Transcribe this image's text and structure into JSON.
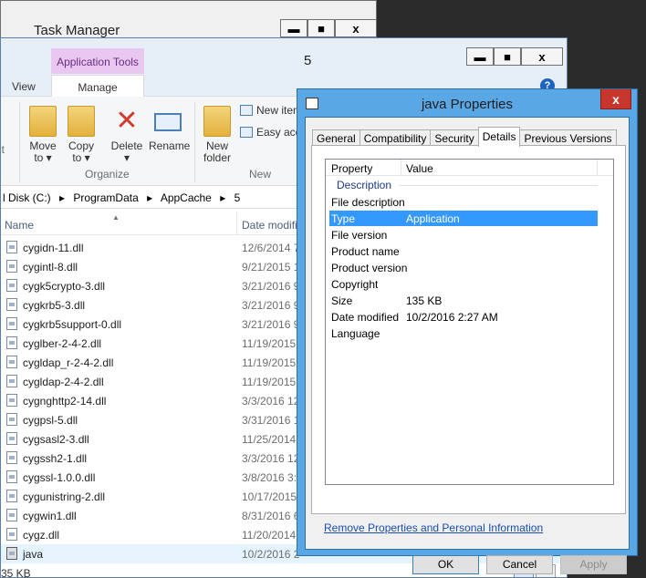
{
  "task_manager": {
    "title": "Task Manager",
    "min": "▬",
    "max": "■",
    "close": "x"
  },
  "explorer": {
    "contextual_tab": "Application Tools",
    "title_number": "5",
    "tabs": {
      "view": "View",
      "manage": "Manage"
    },
    "ribbon": {
      "move_to": "Move\nto ▾",
      "copy_to": "Copy\nto ▾",
      "delete": "Delete\n▾",
      "rename": "Rename",
      "new_folder": "New\nfolder",
      "new_item": "New item",
      "easy_access": "Easy access",
      "group_organize": "Organize",
      "group_new": "New",
      "cut_fragment": "ut"
    },
    "address": [
      "l Disk (C:)",
      "▸",
      "ProgramData",
      "▸",
      "AppCache",
      "▸",
      "5"
    ],
    "columns": {
      "name": "Name",
      "date": "Date modifi"
    },
    "files": [
      {
        "name": "cygidn-11.dll",
        "date": "12/6/2014 7"
      },
      {
        "name": "cygintl-8.dll",
        "date": "9/21/2015 1"
      },
      {
        "name": "cygk5crypto-3.dll",
        "date": "3/21/2016 9"
      },
      {
        "name": "cygkrb5-3.dll",
        "date": "3/21/2016 9"
      },
      {
        "name": "cygkrb5support-0.dll",
        "date": "3/21/2016 9"
      },
      {
        "name": "cyglber-2-4-2.dll",
        "date": "11/19/2015"
      },
      {
        "name": "cygldap_r-2-4-2.dll",
        "date": "11/19/2015"
      },
      {
        "name": "cygldap-2-4-2.dll",
        "date": "11/19/2015"
      },
      {
        "name": "cygnghttp2-14.dll",
        "date": "3/3/2016 12"
      },
      {
        "name": "cygpsl-5.dll",
        "date": "3/31/2016 1"
      },
      {
        "name": "cygsasl2-3.dll",
        "date": "11/25/2014"
      },
      {
        "name": "cygssh2-1.dll",
        "date": "3/3/2016 12"
      },
      {
        "name": "cygssl-1.0.0.dll",
        "date": "3/8/2016 3:4"
      },
      {
        "name": "cygunistring-2.dll",
        "date": "10/17/2015"
      },
      {
        "name": "cygwin1.dll",
        "date": "8/31/2016 6"
      },
      {
        "name": "cygz.dll",
        "date": "11/20/2014"
      },
      {
        "name": "java",
        "date": "10/2/2016 2"
      }
    ],
    "status_size": "35 KB"
  },
  "dialog": {
    "title": "java Properties",
    "close": "x",
    "tabs": [
      "General",
      "Compatibility",
      "Security",
      "Details",
      "Previous Versions"
    ],
    "active_tab": "Details",
    "table": {
      "col_property": "Property",
      "col_value": "Value",
      "section": "Description",
      "rows": [
        {
          "k": "File description",
          "v": ""
        },
        {
          "k": "Type",
          "v": "Application"
        },
        {
          "k": "File version",
          "v": ""
        },
        {
          "k": "Product name",
          "v": ""
        },
        {
          "k": "Product version",
          "v": ""
        },
        {
          "k": "Copyright",
          "v": ""
        },
        {
          "k": "Size",
          "v": "135 KB"
        },
        {
          "k": "Date modified",
          "v": "10/2/2016 2:27 AM"
        },
        {
          "k": "Language",
          "v": ""
        }
      ]
    },
    "link": "Remove Properties and Personal Information",
    "buttons": {
      "ok": "OK",
      "cancel": "Cancel",
      "apply": "Apply"
    }
  }
}
